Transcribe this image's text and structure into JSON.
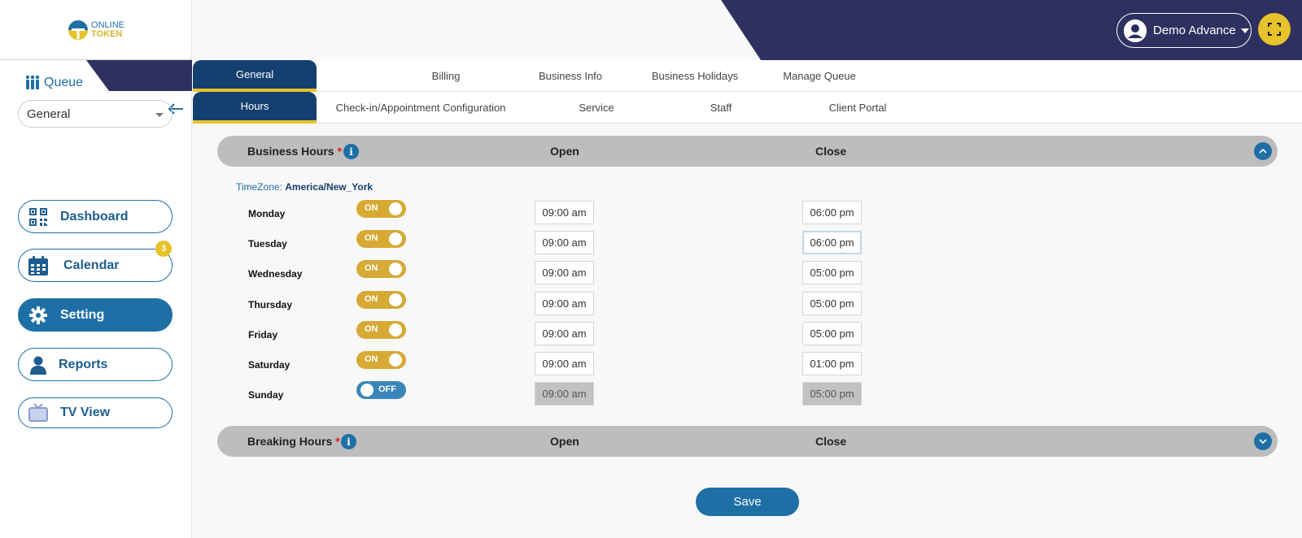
{
  "logo": {
    "line1": "ONLINE",
    "line2": "TOKEN"
  },
  "user": {
    "name": "Demo Advance"
  },
  "sidebar": {
    "queue_label": "Queue",
    "queue_selected": "General",
    "items": [
      {
        "label": "Dashboard",
        "icon": "qr-code-icon"
      },
      {
        "label": "Calendar",
        "icon": "calendar-icon",
        "badge": "3"
      },
      {
        "label": "Setting",
        "icon": "gear-icon"
      },
      {
        "label": "Reports",
        "icon": "user-icon"
      },
      {
        "label": "TV View",
        "icon": "tv-icon"
      }
    ]
  },
  "tabs_top": [
    "General",
    "Billing",
    "Business Info",
    "Business Holidays",
    "Manage Queue"
  ],
  "tabs_sub": [
    "Hours",
    "Check-in/Appointment Configuration",
    "Service",
    "Staff",
    "Client Portal"
  ],
  "business_hours": {
    "title": "Business Hours",
    "required": "*",
    "open_header": "Open",
    "close_header": "Close",
    "timezone_label": "TimeZone:",
    "timezone_value": "America/New_York",
    "days": [
      {
        "day": "Monday",
        "toggle": "ON",
        "open": "09:00 am",
        "close": "06:00 pm"
      },
      {
        "day": "Tuesday",
        "toggle": "ON",
        "open": "09:00 am",
        "close": "06:00 pm"
      },
      {
        "day": "Wednesday",
        "toggle": "ON",
        "open": "09:00 am",
        "close": "05:00 pm"
      },
      {
        "day": "Thursday",
        "toggle": "ON",
        "open": "09:00 am",
        "close": "05:00 pm"
      },
      {
        "day": "Friday",
        "toggle": "ON",
        "open": "09:00 am",
        "close": "05:00 pm"
      },
      {
        "day": "Saturday",
        "toggle": "ON",
        "open": "09:00 am",
        "close": "01:00 pm"
      },
      {
        "day": "Sunday",
        "toggle": "OFF",
        "open": "09:00 am",
        "close": "05:00 pm"
      }
    ]
  },
  "breaking_hours": {
    "title": "Breaking Hours",
    "required": "*",
    "open_header": "Open",
    "close_header": "Close"
  },
  "save_label": "Save",
  "colors": {
    "navy": "#2e3060",
    "accent_yellow": "#e6c32a",
    "blue": "#1e6fa6",
    "toggle_on": "#d6aa34",
    "toggle_off": "#3a86b8"
  }
}
